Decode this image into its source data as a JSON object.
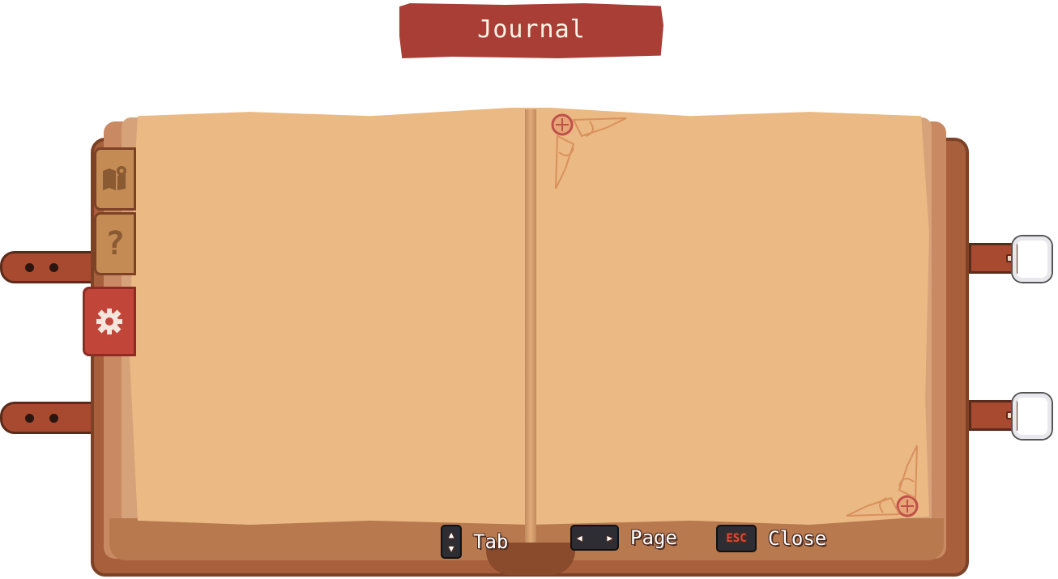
{
  "title": "Journal",
  "tabs": [
    {
      "name": "map",
      "icon": "map-pin-icon"
    },
    {
      "name": "help",
      "icon": "question-icon",
      "glyph": "?"
    },
    {
      "name": "settings",
      "icon": "gear-icon",
      "active": true
    }
  ],
  "controls": {
    "tab": {
      "key_icon": "up-down-key-icon",
      "label": "Tab"
    },
    "page": {
      "key_icon": "left-right-key-icon",
      "label": "Page"
    },
    "close": {
      "key_label": "ESC",
      "label": "Close"
    }
  },
  "colors": {
    "banner": "#a83e35",
    "page": "#ebb983",
    "cover": "#a85f3c",
    "active_tab": "#c2453a"
  }
}
